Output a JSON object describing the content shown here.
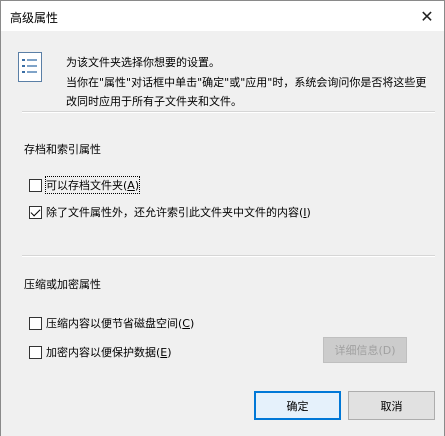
{
  "window": {
    "title": "高级属性",
    "close_glyph": "✕"
  },
  "intro": {
    "line1": "为该文件夹选择你想要的设置。",
    "line2": "当你在\"属性\"对话框中单击\"确定\"或\"应用\"时，系统会询问你是否将这些更改同时应用于所有子文件夹和文件。"
  },
  "archive_section": {
    "title": "存档和索引属性",
    "archive_label": "可以存档文件夹",
    "archive_key": "A",
    "archive_checked": false,
    "index_label": "除了文件属性外，还允许索引此文件夹中文件的内容",
    "index_key": "I",
    "index_checked": true
  },
  "compress_section": {
    "title": "压缩或加密属性",
    "compress_label": "压缩内容以便节省磁盘空间",
    "compress_key": "C",
    "compress_checked": false,
    "encrypt_label": "加密内容以便保护数据",
    "encrypt_key": "E",
    "encrypt_checked": false,
    "details_label": "详细信息(D)"
  },
  "buttons": {
    "ok": "确定",
    "cancel": "取消"
  }
}
